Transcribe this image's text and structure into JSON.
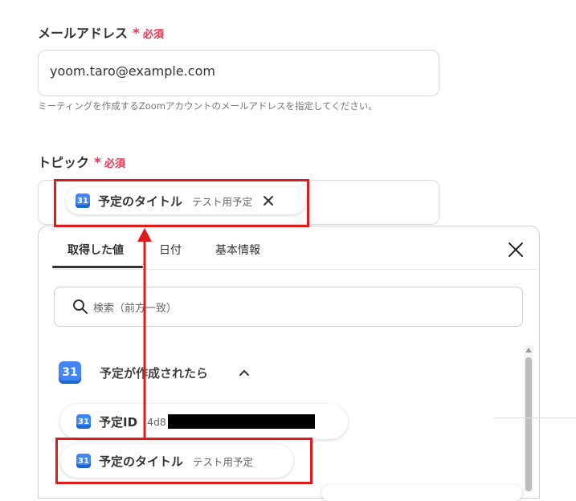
{
  "email_field": {
    "label": "メールアドレス",
    "required_star": "*",
    "required_text": "必須",
    "value": "yoom.taro@example.com",
    "hint": "ミーティングを作成するZoomアカウントのメールアドレスを指定してください。"
  },
  "topic_field": {
    "label": "トピック",
    "required_star": "*",
    "required_text": "必須",
    "chip": {
      "icon_text": "31",
      "label": "予定のタイトル",
      "value": "テスト用予定",
      "remove_icon": "close-icon"
    }
  },
  "picker": {
    "tabs": [
      "取得した値",
      "日付",
      "基本情報"
    ],
    "active_tab": 0,
    "close_icon": "close-icon",
    "search_placeholder": "検索（前方一致）",
    "section": {
      "icon_text": "31",
      "title": "予定が作成されたら",
      "toggle_icon": "chevron-up-icon"
    },
    "items": [
      {
        "icon_text": "31",
        "label": "予定ID",
        "value": "4d8"
      },
      {
        "icon_text": "31",
        "label": "予定のタイトル",
        "value": "テスト用予定"
      }
    ]
  },
  "colors": {
    "required": "#e8344e",
    "highlight": "#e01b1b",
    "calendar_blue": "#4285f4"
  }
}
